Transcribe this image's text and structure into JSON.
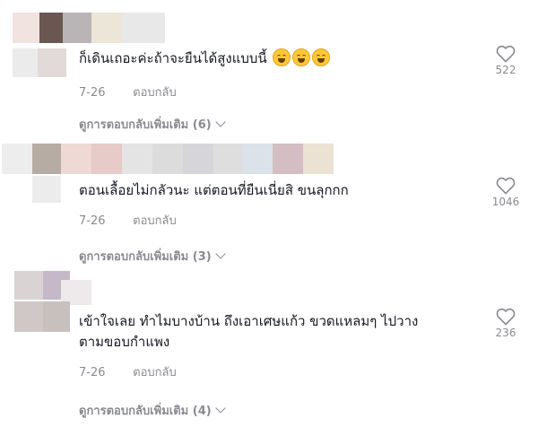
{
  "comments": [
    {
      "text": "ก็เดินเถอะค่ะถ้าจะยืนได้สูงแบบนี้",
      "date": "7-26",
      "reply_label": "ตอบกลับ",
      "more_label": "ดูการตอบกลับเพิ่มเติม (6)",
      "likes": "522",
      "emoji": [
        "face-with-tears-of-joy",
        "face-with-tears-of-joy",
        "face-with-tears-of-joy"
      ],
      "avatar_colors": [
        "#f1e3df",
        "#6b5752",
        "#b9b4b6",
        "#ece6d8",
        "#e8e8e8",
        "#ecebeb",
        "#e2dad8"
      ]
    },
    {
      "text": "ตอนเลื้อยไม่กลัวนะ แต่ตอนที่ยืนเนี่ยสิ ขนลุกกก",
      "date": "7-26",
      "reply_label": "ตอบกลับ",
      "more_label": "ดูการตอบกลับเพิ่มเติม (3)",
      "likes": "1046",
      "avatar_colors": [
        "#ededed",
        "#b6aca3",
        "#eed9d5",
        "#e6cbc8",
        "#dcdcdc",
        "#d6d6da",
        "#dedede",
        "#dbe2ea",
        "#d4bec3",
        "#ece2d3",
        "#e4e4e4"
      ]
    },
    {
      "text_lines": [
        "เข้าใจเลย ทำไมบางบ้าน ถึงเอาเศษแก้ว ขวดแหลมๆ ไปวาง",
        "ตามขอบกำแพง"
      ],
      "date": "7-26",
      "reply_label": "ตอบกลับ",
      "more_label": "ดูการตอบกลับเพิ่มเติม (4)",
      "likes": "236",
      "avatar_colors": [
        "#d9d3d3",
        "#c4b8c9",
        "#eeeaec",
        "#cfc8c6",
        "#c8c0bd"
      ]
    }
  ],
  "icons": {
    "like": "heart-outline-icon",
    "expand": "chevron-down-icon"
  },
  "colors": {
    "text": "#161823",
    "muted": "#8a8b91"
  }
}
